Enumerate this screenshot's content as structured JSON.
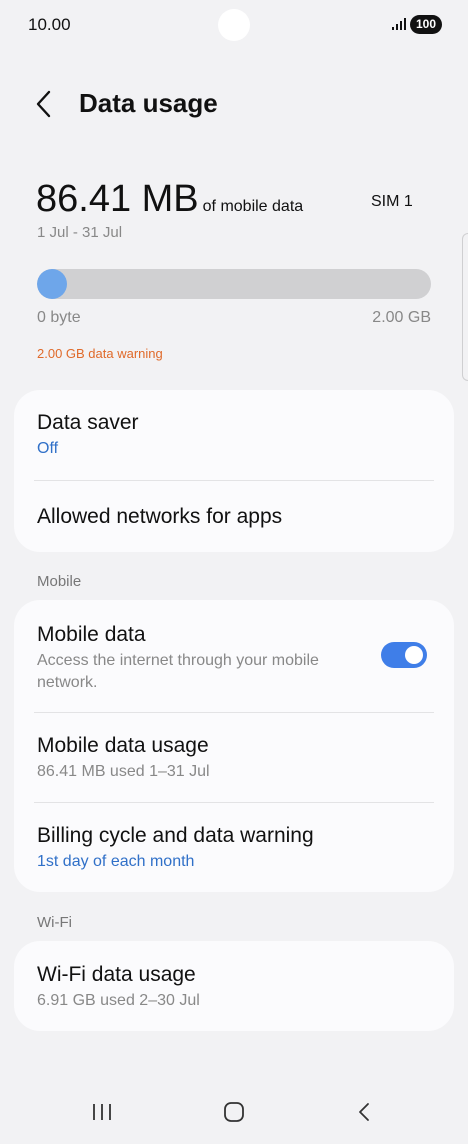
{
  "status_bar": {
    "time": "10.00",
    "battery": "100"
  },
  "header": {
    "title": "Data usage"
  },
  "usage": {
    "value": "86.41 MB",
    "unit_text": "of mobile data",
    "sim": "SIM 1",
    "period": "1 Jul - 31 Jul",
    "progress_fraction": 0.042,
    "range_min": "0 byte",
    "range_max": "2.00 GB",
    "warning": "2.00 GB data warning",
    "warning_color": "#e06a2a",
    "fill_color": "#6ea6ea"
  },
  "card1": {
    "data_saver": {
      "title": "Data saver",
      "value": "Off"
    },
    "allowed_networks": {
      "title": "Allowed networks for apps"
    }
  },
  "mobile_section": {
    "label": "Mobile",
    "mobile_data": {
      "title": "Mobile data",
      "description": "Access the internet through your mobile network.",
      "enabled": true
    },
    "mobile_data_usage": {
      "title": "Mobile data usage",
      "subtitle": "86.41 MB used 1–31 Jul"
    },
    "billing_cycle": {
      "title": "Billing cycle and data warning",
      "subtitle": "1st day of each month"
    }
  },
  "wifi_section": {
    "label": "Wi-Fi",
    "wifi_data_usage": {
      "title": "Wi-Fi data usage",
      "subtitle": "6.91 GB used 2–30 Jul"
    }
  },
  "icons": {
    "back": "chevron-left-icon",
    "signal": "signal-icon",
    "nav_recents": "recents-icon",
    "nav_home": "home-icon",
    "nav_back": "back-icon"
  },
  "colors": {
    "accent": "#3f7ee8",
    "link": "#3070c8",
    "background": "#f2f2f4",
    "card": "#fbfbfd"
  }
}
